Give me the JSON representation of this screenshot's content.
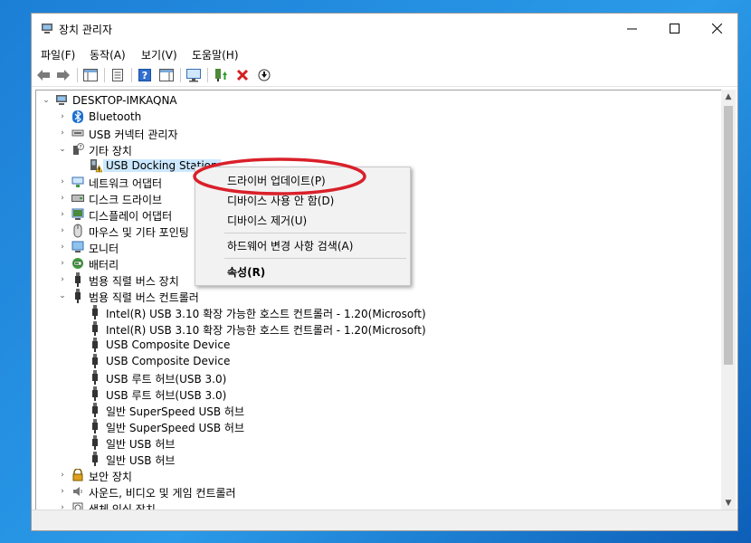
{
  "window": {
    "title": "장치 관리자"
  },
  "menubar": {
    "items": [
      "파일(F)",
      "동작(A)",
      "보기(V)",
      "도움말(H)"
    ]
  },
  "tree": {
    "root": "DESKTOP-IMKAQNA",
    "items": [
      {
        "label": "Bluetooth",
        "icon": "bluetooth-icon",
        "level": 1,
        "state": "collapsed"
      },
      {
        "label": "USB 커넥터 관리자",
        "icon": "usb-connector-icon",
        "level": 1,
        "state": "collapsed"
      },
      {
        "label": "기타 장치",
        "icon": "unknown-device-icon",
        "level": 1,
        "state": "expanded"
      },
      {
        "label": "USB Docking Station",
        "icon": "warning-device-icon",
        "level": 2,
        "state": "leaf",
        "selected": true
      },
      {
        "label": "네트워크 어댑터",
        "icon": "network-adapter-icon",
        "level": 1,
        "state": "collapsed"
      },
      {
        "label": "디스크 드라이브",
        "icon": "disk-drive-icon",
        "level": 1,
        "state": "collapsed"
      },
      {
        "label": "디스플레이 어댑터",
        "icon": "display-adapter-icon",
        "level": 1,
        "state": "collapsed"
      },
      {
        "label": "마우스 및 기타 포인팅",
        "icon": "mouse-icon",
        "level": 1,
        "state": "collapsed"
      },
      {
        "label": "모니터",
        "icon": "monitor-icon",
        "level": 1,
        "state": "collapsed"
      },
      {
        "label": "배터리",
        "icon": "battery-icon",
        "level": 1,
        "state": "collapsed"
      },
      {
        "label": "범용 직렬 버스 장치",
        "icon": "usb-plug-icon",
        "level": 1,
        "state": "collapsed"
      },
      {
        "label": "범용 직렬 버스 컨트롤러",
        "icon": "usb-plug-icon",
        "level": 1,
        "state": "expanded"
      },
      {
        "label": "Intel(R) USB 3.10 확장 가능한 호스트 컨트롤러 - 1.20(Microsoft)",
        "icon": "usb-plug-icon",
        "level": 2,
        "state": "leaf"
      },
      {
        "label": "Intel(R) USB 3.10 확장 가능한 호스트 컨트롤러 - 1.20(Microsoft)",
        "icon": "usb-plug-icon",
        "level": 2,
        "state": "leaf"
      },
      {
        "label": "USB Composite Device",
        "icon": "usb-plug-icon",
        "level": 2,
        "state": "leaf"
      },
      {
        "label": "USB Composite Device",
        "icon": "usb-plug-icon",
        "level": 2,
        "state": "leaf"
      },
      {
        "label": "USB 루트 허브(USB 3.0)",
        "icon": "usb-plug-icon",
        "level": 2,
        "state": "leaf"
      },
      {
        "label": "USB 루트 허브(USB 3.0)",
        "icon": "usb-plug-icon",
        "level": 2,
        "state": "leaf"
      },
      {
        "label": "일반 SuperSpeed USB 허브",
        "icon": "usb-plug-icon",
        "level": 2,
        "state": "leaf"
      },
      {
        "label": "일반 SuperSpeed USB 허브",
        "icon": "usb-plug-icon",
        "level": 2,
        "state": "leaf"
      },
      {
        "label": "일반 USB 허브",
        "icon": "usb-plug-icon",
        "level": 2,
        "state": "leaf"
      },
      {
        "label": "일반 USB 허브",
        "icon": "usb-plug-icon",
        "level": 2,
        "state": "leaf"
      },
      {
        "label": "보안 장치",
        "icon": "security-device-icon",
        "level": 1,
        "state": "collapsed"
      },
      {
        "label": "사운드, 비디오 및 게임 컨트롤러",
        "icon": "speaker-icon",
        "level": 1,
        "state": "collapsed"
      },
      {
        "label": "생체 인식 장치",
        "icon": "biometric-icon",
        "level": 1,
        "state": "collapsed"
      }
    ]
  },
  "context_menu": {
    "items": [
      {
        "label": "드라이버 업데이트(P)",
        "bold": false
      },
      {
        "label": "디바이스 사용 안 함(D)",
        "bold": false
      },
      {
        "label": "디바이스 제거(U)",
        "bold": false
      },
      {
        "label": "하드웨어 변경 사항 검색(A)",
        "bold": false
      },
      {
        "label": "속성(R)",
        "bold": true
      }
    ]
  },
  "colors": {
    "highlight": "#cce8ff",
    "annotation": "#d9202a",
    "accent": "#1976d2"
  }
}
